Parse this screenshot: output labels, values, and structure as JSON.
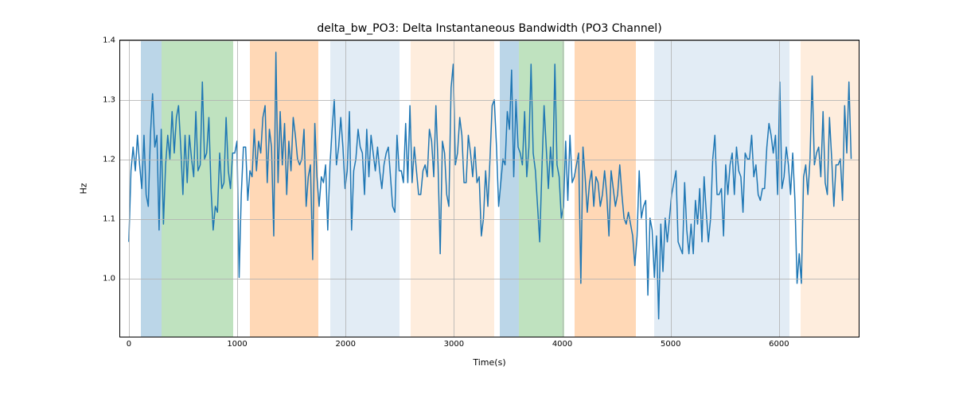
{
  "chart_data": {
    "type": "line",
    "title": "delta_bw_PO3: Delta Instantaneous Bandwidth (PO3 Channel)",
    "xlabel": "Time(s)",
    "ylabel": "Hz",
    "xlim": [
      -80,
      6750
    ],
    "ylim": [
      0.9,
      1.4
    ],
    "xticks": [
      0,
      1000,
      2000,
      3000,
      4000,
      5000,
      6000
    ],
    "yticks": [
      1.0,
      1.1,
      1.2,
      1.3,
      1.4
    ],
    "bands": [
      {
        "x0": 110,
        "x1": 300,
        "color": "blue"
      },
      {
        "x0": 300,
        "x1": 960,
        "color": "green"
      },
      {
        "x0": 1120,
        "x1": 1750,
        "color": "orange"
      },
      {
        "x0": 1860,
        "x1": 2500,
        "color": "lightblue"
      },
      {
        "x0": 2600,
        "x1": 3370,
        "color": "lightorange"
      },
      {
        "x0": 3420,
        "x1": 3600,
        "color": "blue"
      },
      {
        "x0": 3600,
        "x1": 4020,
        "color": "green"
      },
      {
        "x0": 4110,
        "x1": 4680,
        "color": "orange"
      },
      {
        "x0": 4850,
        "x1": 6100,
        "color": "lightblue"
      },
      {
        "x0": 6200,
        "x1": 6750,
        "color": "lightorange"
      }
    ],
    "x": [
      0,
      20,
      40,
      60,
      80,
      100,
      120,
      140,
      160,
      180,
      200,
      220,
      240,
      260,
      280,
      300,
      320,
      340,
      360,
      380,
      400,
      420,
      440,
      460,
      480,
      500,
      520,
      540,
      560,
      580,
      600,
      620,
      640,
      660,
      680,
      700,
      720,
      740,
      760,
      780,
      800,
      820,
      840,
      860,
      880,
      900,
      920,
      940,
      960,
      980,
      1000,
      1020,
      1040,
      1060,
      1080,
      1100,
      1120,
      1140,
      1160,
      1180,
      1200,
      1220,
      1240,
      1260,
      1280,
      1300,
      1320,
      1340,
      1360,
      1380,
      1400,
      1420,
      1440,
      1460,
      1480,
      1500,
      1520,
      1540,
      1560,
      1580,
      1600,
      1620,
      1640,
      1660,
      1680,
      1700,
      1720,
      1740,
      1760,
      1780,
      1800,
      1820,
      1840,
      1860,
      1880,
      1900,
      1920,
      1940,
      1960,
      1980,
      2000,
      2020,
      2040,
      2060,
      2080,
      2100,
      2120,
      2140,
      2160,
      2180,
      2200,
      2220,
      2240,
      2260,
      2280,
      2300,
      2320,
      2340,
      2360,
      2380,
      2400,
      2420,
      2440,
      2460,
      2480,
      2500,
      2520,
      2540,
      2560,
      2580,
      2600,
      2620,
      2640,
      2660,
      2680,
      2700,
      2720,
      2740,
      2760,
      2780,
      2800,
      2820,
      2840,
      2860,
      2880,
      2900,
      2920,
      2940,
      2960,
      2980,
      3000,
      3020,
      3040,
      3060,
      3080,
      3100,
      3120,
      3140,
      3160,
      3180,
      3200,
      3220,
      3240,
      3260,
      3280,
      3300,
      3320,
      3340,
      3360,
      3380,
      3400,
      3420,
      3440,
      3460,
      3480,
      3500,
      3520,
      3540,
      3560,
      3580,
      3600,
      3620,
      3640,
      3660,
      3680,
      3700,
      3720,
      3740,
      3760,
      3780,
      3800,
      3820,
      3840,
      3860,
      3880,
      3900,
      3920,
      3940,
      3960,
      3980,
      4000,
      4020,
      4040,
      4060,
      4080,
      4100,
      4120,
      4140,
      4160,
      4180,
      4200,
      4220,
      4240,
      4260,
      4280,
      4300,
      4320,
      4340,
      4360,
      4380,
      4400,
      4420,
      4440,
      4460,
      4480,
      4500,
      4520,
      4540,
      4560,
      4580,
      4600,
      4620,
      4640,
      4660,
      4680,
      4700,
      4720,
      4740,
      4760,
      4780,
      4800,
      4820,
      4840,
      4860,
      4880,
      4900,
      4920,
      4940,
      4960,
      4980,
      5000,
      5020,
      5040,
      5060,
      5080,
      5100,
      5120,
      5140,
      5160,
      5180,
      5200,
      5220,
      5240,
      5260,
      5280,
      5300,
      5320,
      5340,
      5360,
      5380,
      5400,
      5420,
      5440,
      5460,
      5480,
      5500,
      5520,
      5540,
      5560,
      5580,
      5600,
      5620,
      5640,
      5660,
      5680,
      5700,
      5720,
      5740,
      5760,
      5780,
      5800,
      5820,
      5840,
      5860,
      5880,
      5900,
      5920,
      5940,
      5960,
      5980,
      6000,
      6020,
      6040,
      6060,
      6080,
      6100,
      6120,
      6140,
      6160,
      6180,
      6200,
      6220,
      6240,
      6260,
      6280,
      6300,
      6320,
      6340,
      6360,
      6380,
      6400,
      6420,
      6440,
      6460,
      6480,
      6500,
      6520,
      6540,
      6560,
      6580,
      6600,
      6620,
      6640,
      6660,
      6680
    ],
    "values": [
      1.06,
      1.18,
      1.22,
      1.18,
      1.24,
      1.19,
      1.15,
      1.24,
      1.14,
      1.12,
      1.24,
      1.31,
      1.22,
      1.24,
      1.08,
      1.25,
      1.09,
      1.19,
      1.24,
      1.2,
      1.28,
      1.21,
      1.27,
      1.29,
      1.22,
      1.14,
      1.24,
      1.16,
      1.24,
      1.2,
      1.17,
      1.28,
      1.18,
      1.19,
      1.33,
      1.2,
      1.21,
      1.27,
      1.15,
      1.08,
      1.12,
      1.11,
      1.21,
      1.15,
      1.16,
      1.27,
      1.18,
      1.15,
      1.21,
      1.21,
      1.23,
      1.0,
      1.14,
      1.22,
      1.22,
      1.13,
      1.18,
      1.17,
      1.25,
      1.18,
      1.23,
      1.21,
      1.27,
      1.29,
      1.16,
      1.25,
      1.22,
      1.07,
      1.38,
      1.16,
      1.28,
      1.19,
      1.26,
      1.14,
      1.23,
      1.18,
      1.27,
      1.24,
      1.2,
      1.19,
      1.2,
      1.25,
      1.12,
      1.17,
      1.19,
      1.03,
      1.26,
      1.17,
      1.12,
      1.17,
      1.16,
      1.19,
      1.08,
      1.19,
      1.25,
      1.3,
      1.19,
      1.22,
      1.27,
      1.22,
      1.15,
      1.18,
      1.28,
      1.08,
      1.18,
      1.2,
      1.25,
      1.22,
      1.21,
      1.14,
      1.25,
      1.17,
      1.24,
      1.21,
      1.18,
      1.22,
      1.18,
      1.15,
      1.19,
      1.21,
      1.22,
      1.17,
      1.12,
      1.11,
      1.24,
      1.18,
      1.18,
      1.16,
      1.26,
      1.16,
      1.29,
      1.16,
      1.22,
      1.18,
      1.14,
      1.14,
      1.18,
      1.19,
      1.17,
      1.25,
      1.23,
      1.17,
      1.29,
      1.19,
      1.04,
      1.23,
      1.21,
      1.14,
      1.12,
      1.32,
      1.36,
      1.19,
      1.21,
      1.27,
      1.24,
      1.16,
      1.16,
      1.24,
      1.21,
      1.17,
      1.22,
      1.16,
      1.17,
      1.07,
      1.1,
      1.18,
      1.12,
      1.2,
      1.29,
      1.3,
      1.22,
      1.12,
      1.16,
      1.2,
      1.19,
      1.28,
      1.25,
      1.35,
      1.17,
      1.3,
      1.22,
      1.21,
      1.19,
      1.28,
      1.17,
      1.22,
      1.36,
      1.21,
      1.18,
      1.12,
      1.06,
      1.18,
      1.29,
      1.22,
      1.15,
      1.22,
      1.17,
      1.36,
      1.19,
      1.17,
      1.1,
      1.12,
      1.23,
      1.13,
      1.24,
      1.16,
      1.17,
      1.19,
      1.21,
      0.99,
      1.22,
      1.17,
      1.11,
      1.16,
      1.18,
      1.12,
      1.17,
      1.16,
      1.12,
      1.14,
      1.18,
      1.14,
      1.07,
      1.18,
      1.15,
      1.12,
      1.14,
      1.19,
      1.14,
      1.1,
      1.09,
      1.11,
      1.09,
      1.07,
      1.02,
      1.07,
      1.18,
      1.1,
      1.12,
      1.13,
      0.97,
      1.1,
      1.08,
      1.0,
      1.07,
      0.93,
      1.09,
      1.01,
      1.1,
      1.06,
      1.1,
      1.14,
      1.16,
      1.18,
      1.06,
      1.05,
      1.04,
      1.16,
      1.08,
      1.04,
      1.09,
      1.04,
      1.13,
      1.09,
      1.15,
      1.06,
      1.17,
      1.11,
      1.06,
      1.1,
      1.2,
      1.24,
      1.14,
      1.14,
      1.15,
      1.07,
      1.19,
      1.14,
      1.19,
      1.21,
      1.14,
      1.22,
      1.18,
      1.17,
      1.11,
      1.21,
      1.2,
      1.2,
      1.24,
      1.17,
      1.19,
      1.14,
      1.13,
      1.15,
      1.15,
      1.22,
      1.26,
      1.24,
      1.21,
      1.24,
      1.14,
      1.33,
      1.15,
      1.17,
      1.22,
      1.19,
      1.14,
      1.21,
      1.13,
      0.99,
      1.04,
      0.99,
      1.17,
      1.19,
      1.14,
      1.2,
      1.34,
      1.19,
      1.21,
      1.22,
      1.17,
      1.28,
      1.16,
      1.14,
      1.27,
      1.2,
      1.12,
      1.19,
      1.19,
      1.2,
      1.13,
      1.29,
      1.21,
      1.33,
      1.2
    ]
  }
}
